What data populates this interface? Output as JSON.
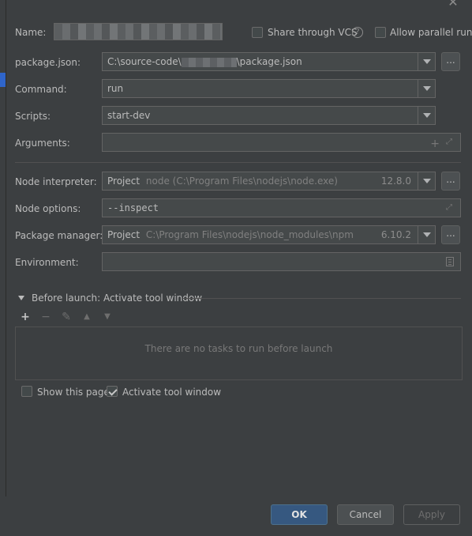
{
  "window": {
    "close_icon": "close-icon"
  },
  "name": {
    "label": "Name:"
  },
  "share_vcs": {
    "label": "Share through VCS",
    "checked": false
  },
  "allow_parallel": {
    "label": "Allow parallel run",
    "checked": false
  },
  "package_json": {
    "label": "package.json:",
    "value_prefix": "C:\\source-code\\",
    "value_suffix": "\\package.json",
    "browse": "..."
  },
  "command": {
    "label": "Command:",
    "value": "run"
  },
  "scripts": {
    "label": "Scripts:",
    "value": "start-dev"
  },
  "arguments": {
    "label": "Arguments:",
    "value": ""
  },
  "node_interpreter": {
    "label": "Node interpreter:",
    "kind": "Project",
    "path": "node (C:\\Program Files\\nodejs\\node.exe)",
    "version": "12.8.0",
    "browse": "..."
  },
  "node_options": {
    "label": "Node options:",
    "value": "--inspect"
  },
  "package_manager": {
    "label": "Package manager:",
    "kind": "Project",
    "path": "C:\\Program Files\\nodejs\\node_modules\\npm",
    "version": "6.10.2",
    "browse": "..."
  },
  "environment": {
    "label": "Environment:",
    "value": ""
  },
  "before_launch": {
    "title": "Before launch: Activate tool window",
    "empty_text": "There are no tasks to run before launch"
  },
  "show_this_page": {
    "label": "Show this page",
    "checked": false
  },
  "activate_tool_window": {
    "label": "Activate tool window",
    "checked": true
  },
  "buttons": {
    "ok": "OK",
    "cancel": "Cancel",
    "apply": "Apply"
  }
}
